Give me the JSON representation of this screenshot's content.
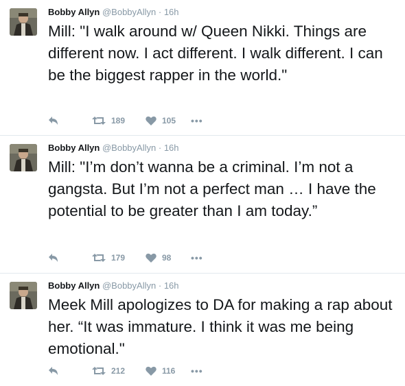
{
  "tweets": [
    {
      "author_name": "Bobby Allyn",
      "author_handle": "@BobbyAllyn",
      "separator": "·",
      "time": "16h",
      "text": "Mill: \"I walk around w/ Queen Nikki. Things are different now. I act different. I walk different. I can be the biggest rapper in the world.\"",
      "retweets": "189",
      "likes": "105"
    },
    {
      "author_name": "Bobby Allyn",
      "author_handle": "@BobbyAllyn",
      "separator": "·",
      "time": "16h",
      "text": "Mill: \"I’m don’t wanna be a criminal. I’m not a gangsta. But I’m not a perfect man … I have the potential to be greater than I am today.”",
      "retweets": "179",
      "likes": "98"
    },
    {
      "author_name": "Bobby Allyn",
      "author_handle": "@BobbyAllyn",
      "separator": "·",
      "time": "16h",
      "text": "Meek Mill apologizes to DA for making a rap about her.  “It was immature. I think it was me being emotional.\"",
      "retweets": "212",
      "likes": "116"
    }
  ],
  "icons": {
    "reply": "reply-icon",
    "retweet": "retweet-icon",
    "like": "heart-icon",
    "more": "more-icon"
  },
  "more_glyph": "•••",
  "colors": {
    "text": "#14171a",
    "secondary": "#8899a6",
    "divider": "#e1e8ed"
  }
}
